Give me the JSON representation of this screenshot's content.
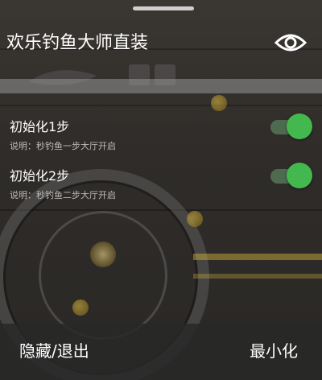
{
  "app": {
    "title": "欢乐钓鱼大师直装"
  },
  "header": {
    "visibility_icon": "eye-icon"
  },
  "options": [
    {
      "label": "初始化1步",
      "description": "说明：秒钓鱼一步大厅开启",
      "enabled": true
    },
    {
      "label": "初始化2步",
      "description": "说明：秒钓鱼二步大厅开启",
      "enabled": true
    }
  ],
  "footer": {
    "hide_exit_label": "隐藏/退出",
    "minimize_label": "最小化"
  },
  "colors": {
    "switch_on": "#43b84e",
    "switch_track_on": "#4f6b4f",
    "text_primary": "#ffffff",
    "text_secondary": "#bdbdbd"
  }
}
